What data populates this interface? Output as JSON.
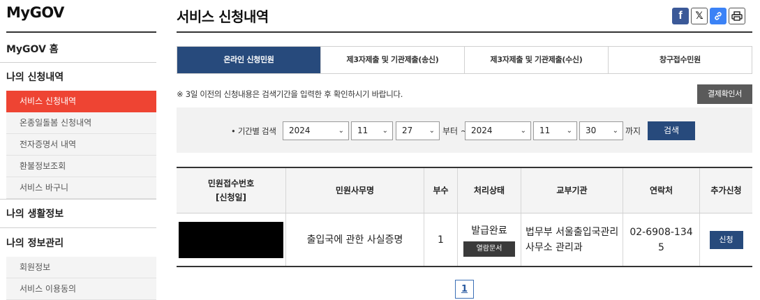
{
  "sidebar": {
    "brand": "MyGOV",
    "home": "MyGOV 홈",
    "sections": [
      "나의 신청내역",
      "나의 생활정보",
      "나의 정보관리"
    ],
    "applications_items": [
      "서비스 신청내역",
      "온종일돌봄 신청내역",
      "전자증명서 내역",
      "환불정보조회",
      "서비스 바구니"
    ],
    "account_items": [
      "회원정보",
      "서비스 이용동의"
    ]
  },
  "page": {
    "title": "서비스 신청내역"
  },
  "share": {
    "facebook": "f",
    "x": "𝕏",
    "link": "🔗",
    "print": "⎙"
  },
  "tabs": [
    "온라인 신청민원",
    "제3자제출 및 기관제출(송신)",
    "제3자제출 및 기관제출(수신)",
    "창구접수민원"
  ],
  "notice": "※ 3일 이전의 신청내용은 검색기간을 입력한 후 확인하시기 바랍니다.",
  "confirm_button": "결제확인서",
  "search": {
    "label": "• 기간별 검색",
    "start_year": "2024",
    "start_month": "11",
    "start_day": "27",
    "from_text": "부터 ~",
    "end_year": "2024",
    "end_month": "11",
    "end_day": "30",
    "to_text": "까지",
    "button": "검색"
  },
  "table": {
    "headers": [
      "민원접수번호",
      "[신청일]",
      "민원사무명",
      "부수",
      "처리상태",
      "교부기관",
      "연락처",
      "추가신청"
    ],
    "rows": [
      {
        "service_name": "출입국에 관한 사실증명",
        "copies": "1",
        "status": "발급완료",
        "doc_button": "열람문서",
        "agency_line1": "법무부 서울출입국관리",
        "agency_line2": "사무소 관리과",
        "phone_line1": "02-6908-134",
        "phone_line2": "5",
        "apply_button": "신청"
      }
    ]
  },
  "pagination": {
    "current": "1"
  },
  "icons": {
    "chevron": "⌄"
  },
  "colors": {
    "accent_red": "#ee4433",
    "navy": "#274a7c"
  }
}
